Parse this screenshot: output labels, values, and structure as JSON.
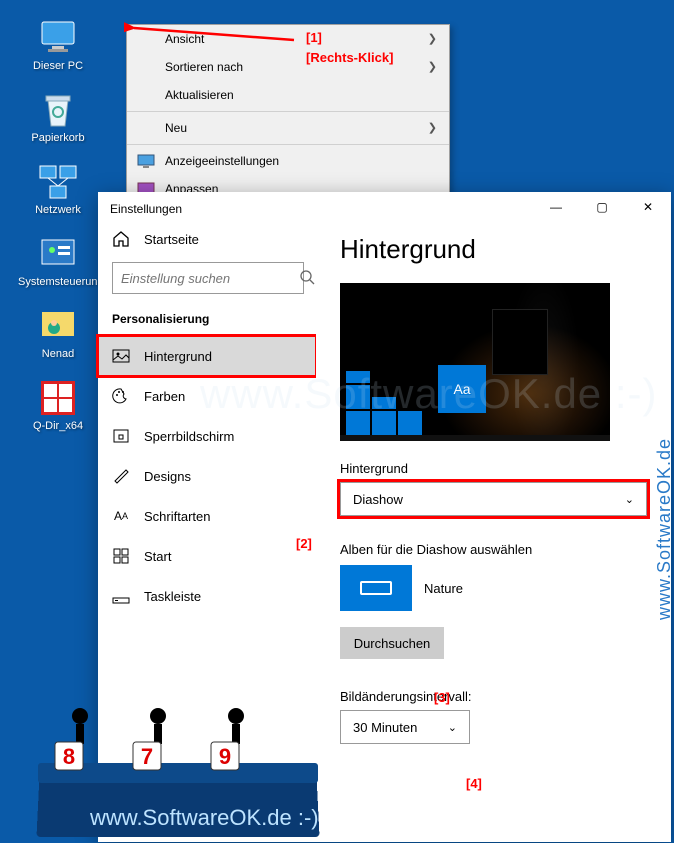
{
  "desktop": {
    "icons": [
      {
        "label": "Dieser PC"
      },
      {
        "label": "Papierkorb"
      },
      {
        "label": "Netzwerk"
      },
      {
        "label": "Systemsteuerung"
      },
      {
        "label": "Nenad"
      },
      {
        "label": "Q-Dir_x64"
      }
    ]
  },
  "context_menu": {
    "items": [
      {
        "label": "Ansicht",
        "arrow": true
      },
      {
        "label": "Sortieren nach",
        "arrow": true
      },
      {
        "label": "Aktualisieren"
      },
      {
        "sep": true
      },
      {
        "label": "Neu",
        "arrow": true
      },
      {
        "sep": true
      },
      {
        "label": "Anzeigeeinstellungen",
        "icon": "display"
      },
      {
        "label": "Anpassen",
        "icon": "personalize"
      }
    ]
  },
  "settings": {
    "window_title": "Einstellungen",
    "home": "Startseite",
    "search_placeholder": "Einstellung suchen",
    "section": "Personalisierung",
    "nav": [
      {
        "label": "Hintergrund",
        "icon": "picture",
        "active": true
      },
      {
        "label": "Farben",
        "icon": "palette"
      },
      {
        "label": "Sperrbildschirm",
        "icon": "lock"
      },
      {
        "label": "Designs",
        "icon": "brush"
      },
      {
        "label": "Schriftarten",
        "icon": "font"
      },
      {
        "label": "Start",
        "icon": "start"
      },
      {
        "label": "Taskleiste",
        "icon": "taskbar"
      }
    ],
    "page_title": "Hintergrund",
    "bg_label": "Hintergrund",
    "bg_value": "Diashow",
    "album_label": "Alben für die Diashow auswählen",
    "album_name": "Nature",
    "browse": "Durchsuchen",
    "interval_label": "Bildänderungsintervall:",
    "interval_value": "30 Minuten",
    "preview_aa": "Aa"
  },
  "annotations": {
    "a1": "[1]",
    "a1_text": "[Rechts-Klick]",
    "a2": "[2]",
    "a3": "[3]",
    "a4": "[4]",
    "n8": "8",
    "n7": "7",
    "n9": "9"
  },
  "watermarks": {
    "side": "www.SoftwareOK.de :-)",
    "footer": "www.SoftwareOK.de :-)"
  }
}
